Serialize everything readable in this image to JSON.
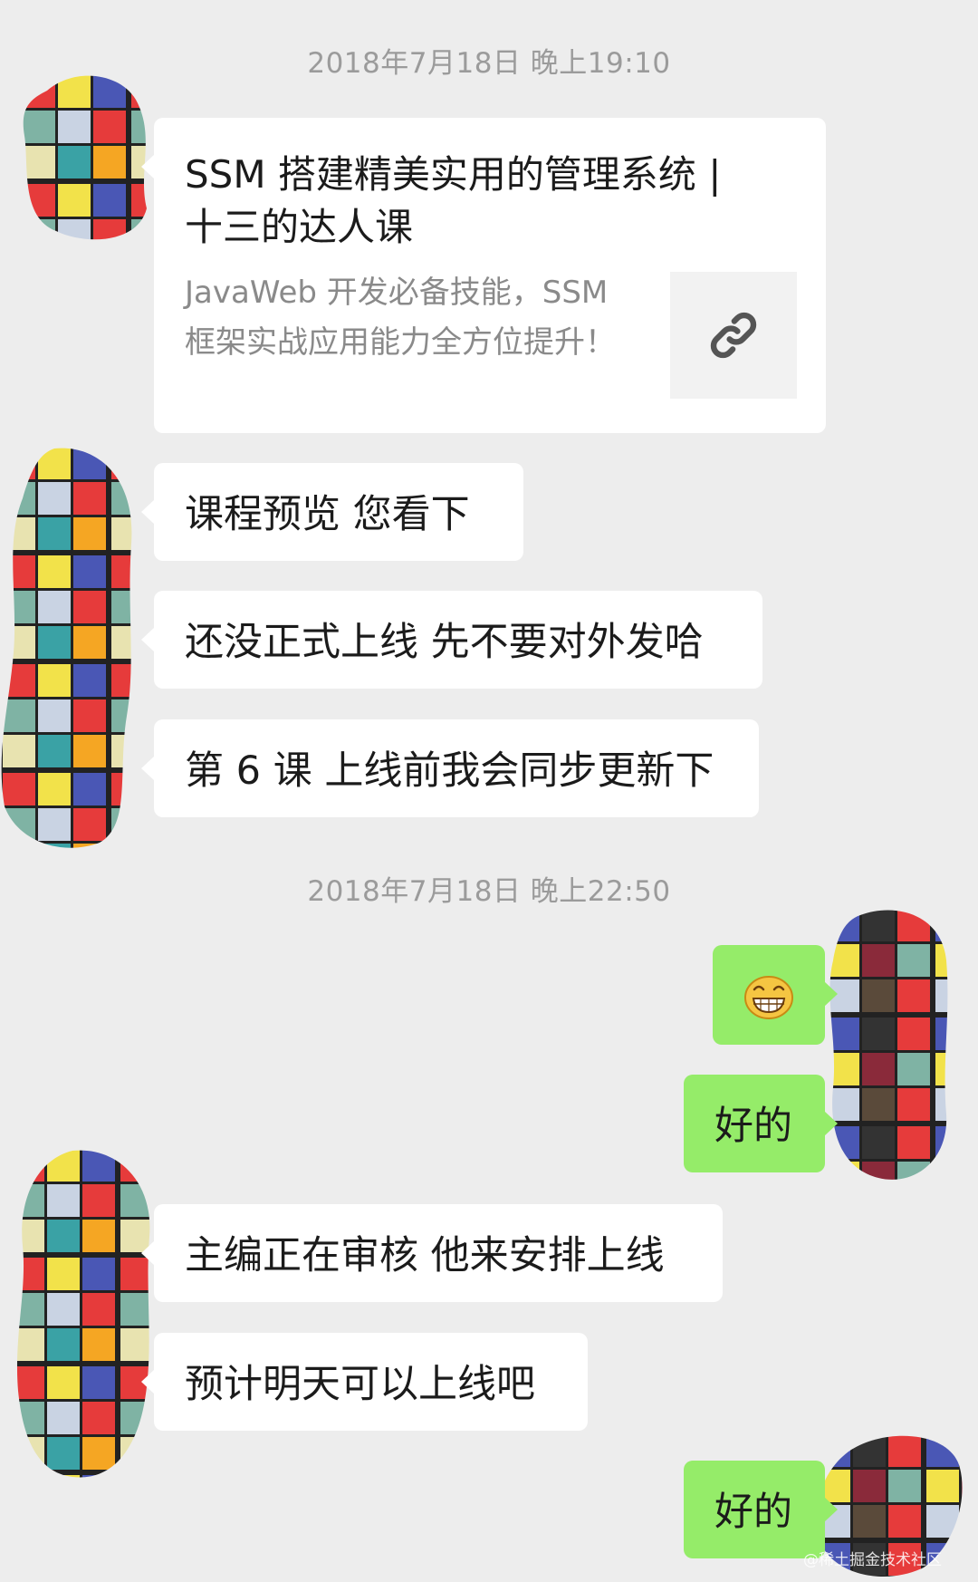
{
  "timestamps": [
    "2018年7月18日 晚上19:10",
    "2018年7月18日 晚上22:50"
  ],
  "link_card": {
    "title": "SSM 搭建精美实用的管理系统 | 十三的达人课",
    "description": "JavaWeb 开发必备技能，SSM 框架实战应用能力全方位提升！",
    "icon": "link-icon"
  },
  "messages": [
    {
      "side": "left",
      "text": "课程预览  您看下"
    },
    {
      "side": "left",
      "text": "还没正式上线 先不要对外发哈"
    },
    {
      "side": "left",
      "text": "第 6 课 上线前我会同步更新下"
    },
    {
      "side": "right",
      "text": "",
      "emoji": "grinning-face-icon"
    },
    {
      "side": "right",
      "text": "好的"
    },
    {
      "side": "left",
      "text": "主编正在审核 他来安排上线"
    },
    {
      "side": "left",
      "text": "预计明天可以上线吧"
    },
    {
      "side": "right",
      "text": "好的"
    }
  ],
  "watermark": "@稀土掘金技术社区",
  "colors": {
    "background": "#ededed",
    "incoming_bubble": "#ffffff",
    "outgoing_bubble": "#95ec69",
    "timestamp": "#9b9b9b"
  }
}
